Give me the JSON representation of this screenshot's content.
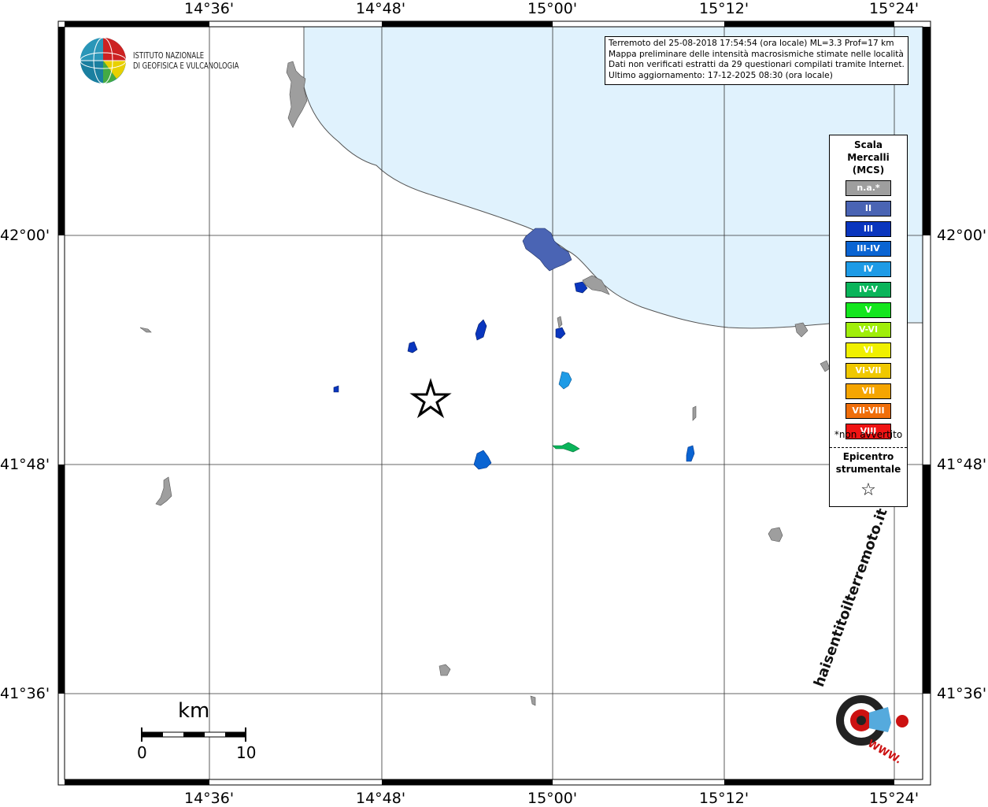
{
  "map": {
    "grid_labels": {
      "lon": [
        "14°36'",
        "14°48'",
        "15°00'",
        "15°12'",
        "15°24'"
      ],
      "lat": [
        "42°00'",
        "41°48'",
        "41°36'"
      ]
    },
    "info_lines": [
      "Terremoto del 25-08-2018 17:54:54 (ora locale) ML=3.3 Prof=17 km",
      "Mappa preliminare delle intensità macrosismiche stimate nelle località",
      "Dati non verificati estratti da 29 questionari compilati tramite Internet.",
      "Ultimo aggiornamento: 17-12-2025 08:30 (ora locale)"
    ],
    "logo": {
      "line1": "ISTITUTO NAZIONALE",
      "line2": "DI GEOFISICA E VULCANOLOGIA"
    },
    "legend": {
      "title_lines": [
        "Scala",
        "Mercalli",
        "(MCS)"
      ],
      "items": [
        {
          "label": "n.a.*",
          "color": "#9e9e9e"
        },
        {
          "label": "II",
          "color": "#4a64b4"
        },
        {
          "label": "III",
          "color": "#0a36be"
        },
        {
          "label": "III-IV",
          "color": "#0a64d2"
        },
        {
          "label": "IV",
          "color": "#1e9be6"
        },
        {
          "label": "IV-V",
          "color": "#0ab45a"
        },
        {
          "label": "V",
          "color": "#14e61e"
        },
        {
          "label": "V-VI",
          "color": "#a0ee0a"
        },
        {
          "label": "VI",
          "color": "#f0f000"
        },
        {
          "label": "VI-VII",
          "color": "#f0c800"
        },
        {
          "label": "VII",
          "color": "#f5a500"
        },
        {
          "label": "VII-VIII",
          "color": "#f06e0a"
        },
        {
          "label": "VIII",
          "color": "#f01414"
        }
      ],
      "note": "*non avvertito",
      "epicenter_lines": [
        "Epicentro",
        "strumentale"
      ],
      "epicenter_symbol": "☆"
    },
    "scale_bar": {
      "unit": "km",
      "min": "0",
      "max": "10"
    },
    "watermark": {
      "brand": "haisentitoilterremoto.it",
      "www": "WWW."
    },
    "colors": {
      "sea": "#e0f2fd",
      "land": "#ffffff",
      "not_felt": "#9e9e9e",
      "intensity_II": "#4a64b4",
      "intensity_III": "#0a36be",
      "intensity_III_IV": "#0a64d2",
      "intensity_IV": "#1e9be6",
      "intensity_IV_V": "#0ab45a"
    }
  }
}
